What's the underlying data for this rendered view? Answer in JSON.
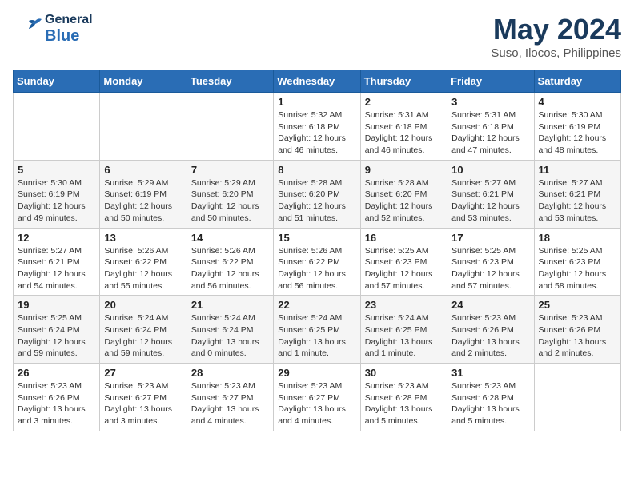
{
  "header": {
    "logo_general": "General",
    "logo_blue": "Blue",
    "month": "May 2024",
    "location": "Suso, Ilocos, Philippines"
  },
  "weekdays": [
    "Sunday",
    "Monday",
    "Tuesday",
    "Wednesday",
    "Thursday",
    "Friday",
    "Saturday"
  ],
  "weeks": [
    [
      {
        "day": "",
        "info": ""
      },
      {
        "day": "",
        "info": ""
      },
      {
        "day": "",
        "info": ""
      },
      {
        "day": "1",
        "info": "Sunrise: 5:32 AM\nSunset: 6:18 PM\nDaylight: 12 hours\nand 46 minutes."
      },
      {
        "day": "2",
        "info": "Sunrise: 5:31 AM\nSunset: 6:18 PM\nDaylight: 12 hours\nand 46 minutes."
      },
      {
        "day": "3",
        "info": "Sunrise: 5:31 AM\nSunset: 6:18 PM\nDaylight: 12 hours\nand 47 minutes."
      },
      {
        "day": "4",
        "info": "Sunrise: 5:30 AM\nSunset: 6:19 PM\nDaylight: 12 hours\nand 48 minutes."
      }
    ],
    [
      {
        "day": "5",
        "info": "Sunrise: 5:30 AM\nSunset: 6:19 PM\nDaylight: 12 hours\nand 49 minutes."
      },
      {
        "day": "6",
        "info": "Sunrise: 5:29 AM\nSunset: 6:19 PM\nDaylight: 12 hours\nand 50 minutes."
      },
      {
        "day": "7",
        "info": "Sunrise: 5:29 AM\nSunset: 6:20 PM\nDaylight: 12 hours\nand 50 minutes."
      },
      {
        "day": "8",
        "info": "Sunrise: 5:28 AM\nSunset: 6:20 PM\nDaylight: 12 hours\nand 51 minutes."
      },
      {
        "day": "9",
        "info": "Sunrise: 5:28 AM\nSunset: 6:20 PM\nDaylight: 12 hours\nand 52 minutes."
      },
      {
        "day": "10",
        "info": "Sunrise: 5:27 AM\nSunset: 6:21 PM\nDaylight: 12 hours\nand 53 minutes."
      },
      {
        "day": "11",
        "info": "Sunrise: 5:27 AM\nSunset: 6:21 PM\nDaylight: 12 hours\nand 53 minutes."
      }
    ],
    [
      {
        "day": "12",
        "info": "Sunrise: 5:27 AM\nSunset: 6:21 PM\nDaylight: 12 hours\nand 54 minutes."
      },
      {
        "day": "13",
        "info": "Sunrise: 5:26 AM\nSunset: 6:22 PM\nDaylight: 12 hours\nand 55 minutes."
      },
      {
        "day": "14",
        "info": "Sunrise: 5:26 AM\nSunset: 6:22 PM\nDaylight: 12 hours\nand 56 minutes."
      },
      {
        "day": "15",
        "info": "Sunrise: 5:26 AM\nSunset: 6:22 PM\nDaylight: 12 hours\nand 56 minutes."
      },
      {
        "day": "16",
        "info": "Sunrise: 5:25 AM\nSunset: 6:23 PM\nDaylight: 12 hours\nand 57 minutes."
      },
      {
        "day": "17",
        "info": "Sunrise: 5:25 AM\nSunset: 6:23 PM\nDaylight: 12 hours\nand 57 minutes."
      },
      {
        "day": "18",
        "info": "Sunrise: 5:25 AM\nSunset: 6:23 PM\nDaylight: 12 hours\nand 58 minutes."
      }
    ],
    [
      {
        "day": "19",
        "info": "Sunrise: 5:25 AM\nSunset: 6:24 PM\nDaylight: 12 hours\nand 59 minutes."
      },
      {
        "day": "20",
        "info": "Sunrise: 5:24 AM\nSunset: 6:24 PM\nDaylight: 12 hours\nand 59 minutes."
      },
      {
        "day": "21",
        "info": "Sunrise: 5:24 AM\nSunset: 6:24 PM\nDaylight: 13 hours\nand 0 minutes."
      },
      {
        "day": "22",
        "info": "Sunrise: 5:24 AM\nSunset: 6:25 PM\nDaylight: 13 hours\nand 1 minute."
      },
      {
        "day": "23",
        "info": "Sunrise: 5:24 AM\nSunset: 6:25 PM\nDaylight: 13 hours\nand 1 minute."
      },
      {
        "day": "24",
        "info": "Sunrise: 5:23 AM\nSunset: 6:26 PM\nDaylight: 13 hours\nand 2 minutes."
      },
      {
        "day": "25",
        "info": "Sunrise: 5:23 AM\nSunset: 6:26 PM\nDaylight: 13 hours\nand 2 minutes."
      }
    ],
    [
      {
        "day": "26",
        "info": "Sunrise: 5:23 AM\nSunset: 6:26 PM\nDaylight: 13 hours\nand 3 minutes."
      },
      {
        "day": "27",
        "info": "Sunrise: 5:23 AM\nSunset: 6:27 PM\nDaylight: 13 hours\nand 3 minutes."
      },
      {
        "day": "28",
        "info": "Sunrise: 5:23 AM\nSunset: 6:27 PM\nDaylight: 13 hours\nand 4 minutes."
      },
      {
        "day": "29",
        "info": "Sunrise: 5:23 AM\nSunset: 6:27 PM\nDaylight: 13 hours\nand 4 minutes."
      },
      {
        "day": "30",
        "info": "Sunrise: 5:23 AM\nSunset: 6:28 PM\nDaylight: 13 hours\nand 5 minutes."
      },
      {
        "day": "31",
        "info": "Sunrise: 5:23 AM\nSunset: 6:28 PM\nDaylight: 13 hours\nand 5 minutes."
      },
      {
        "day": "",
        "info": ""
      }
    ]
  ]
}
